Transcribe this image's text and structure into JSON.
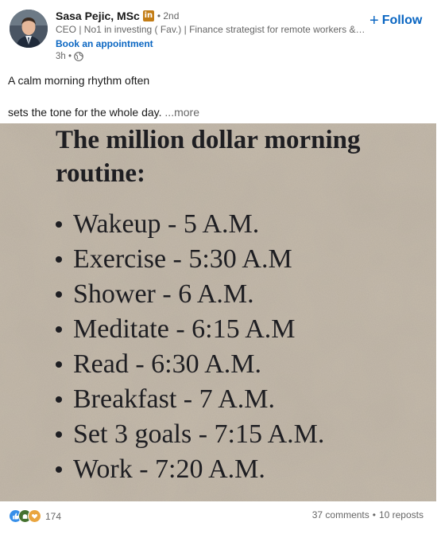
{
  "author": {
    "name": "Sasa Pejic, MSc",
    "badge": "in",
    "degree": "• 2nd",
    "headline": "CEO | No1 in investing ( Fav.) | Finance strategist for remote workers & ...",
    "book_link": "Book an appointment",
    "time": "3h •"
  },
  "follow_label": "Follow",
  "follow_plus": "+",
  "post": {
    "line1": "A calm morning rhythm often",
    "line2": "sets the tone for the whole day.",
    "more": "...more"
  },
  "image": {
    "title_line1": "The million dollar morning",
    "title_line2": "routine:",
    "items": [
      "Wakeup - 5 A.M.",
      "Exercise - 5:30 A.M",
      "Shower - 6 A.M.",
      "Meditate - 6:15 A.M",
      "Read - 6:30 A.M.",
      "Breakfast - 7 A.M.",
      "Set 3 goals - 7:15 A.M.",
      "Work - 7:20 A.M."
    ]
  },
  "footer": {
    "reaction_count": "174",
    "comments": "37 comments",
    "separator": "•",
    "reposts": "10 reposts"
  },
  "colors": {
    "link": "#0a66c2",
    "muted": "#666666",
    "premium": "#c37d16",
    "paper": "#c4b8a8"
  },
  "icons": [
    "globe-icon",
    "like-reaction-icon",
    "celebrate-reaction-icon",
    "support-reaction-icon",
    "linkedin-premium-icon",
    "plus-icon"
  ]
}
